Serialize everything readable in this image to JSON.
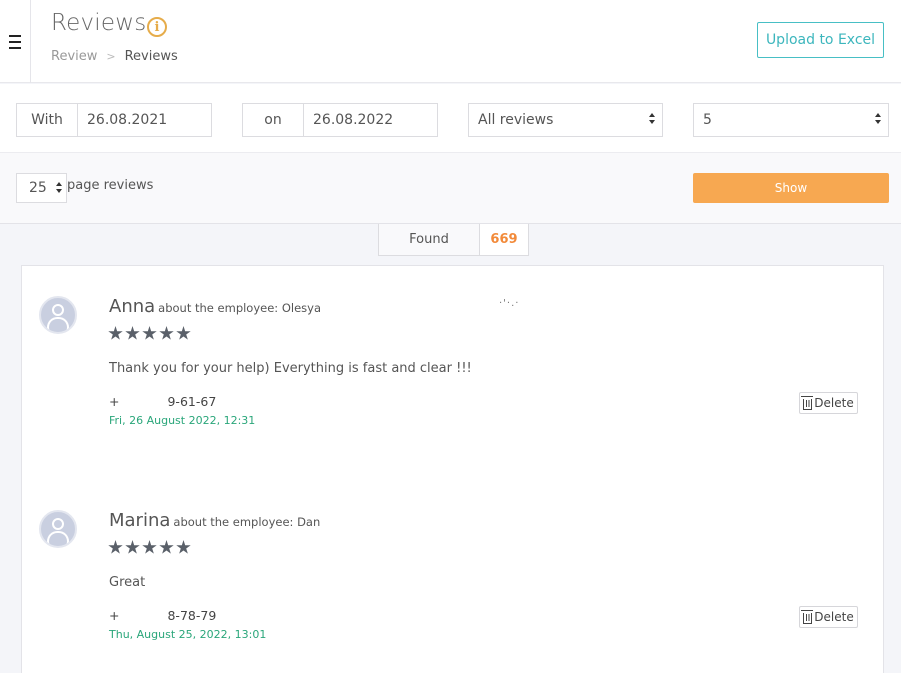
{
  "header": {
    "title": "Reviews",
    "breadcrumb": {
      "parent": "Review",
      "separator": ">",
      "current": "Reviews"
    },
    "upload_label": "Upload to Excel"
  },
  "filters": {
    "from_label": "With",
    "from_value": "26.08.2021",
    "to_label": "on",
    "to_value": "26.08.2022",
    "type_select": "All reviews",
    "rating_select": "5"
  },
  "paging": {
    "per_page_value": "25",
    "per_page_label": "page reviews",
    "show_label": "Show"
  },
  "found": {
    "label": "Found",
    "count": "669"
  },
  "reviews": [
    {
      "name": "Anna",
      "about": "about the employee: Olesya",
      "rating": 5,
      "text": "Thank you for your help) Everything is fast and clear !!!",
      "phone_prefix": "+",
      "phone_suffix": "9-61-67",
      "date": "Fri, 26 August 2022, 12:31",
      "delete_label": "Delete"
    },
    {
      "name": "Marina",
      "about": "about the employee: Dan",
      "rating": 5,
      "text": "Great",
      "phone_prefix": "+",
      "phone_suffix": "8-78-79",
      "date": "Thu, August 25, 2022, 13:01",
      "delete_label": "Delete"
    }
  ],
  "colors": {
    "accent_teal": "#3cb6bd",
    "show_orange": "#f7a851",
    "count_orange": "#f28a3a",
    "date_green": "#2aa67a",
    "info_yellow": "#e6ac4a"
  }
}
